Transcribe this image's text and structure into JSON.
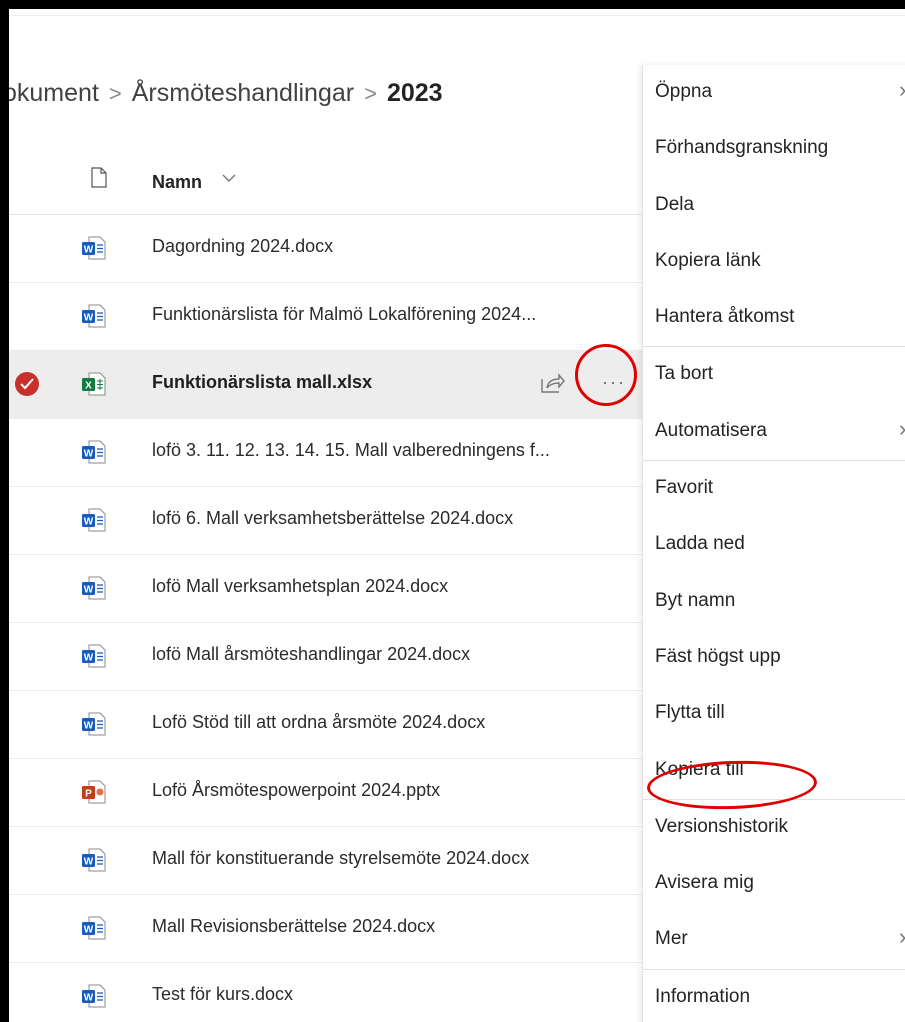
{
  "breadcrumb": {
    "part1": "okument",
    "part2": "Årsmöteshandlingar",
    "current": "2023"
  },
  "list": {
    "header": {
      "name": "Namn",
      "sort_icon": "chevron-down-icon"
    },
    "files": [
      {
        "name": "Dagordning 2024.docx",
        "type": "word"
      },
      {
        "name": "Funktionärslista för Malmö Lokalförening 2024...",
        "type": "word"
      },
      {
        "name": "Funktionärslista mall.xlsx",
        "type": "excel",
        "selected": true
      },
      {
        "name": "lofö 3. 11. 12. 13. 14. 15. Mall valberedningens f...",
        "type": "word"
      },
      {
        "name": "lofö 6. Mall verksamhetsberättelse 2024.docx",
        "type": "word"
      },
      {
        "name": "lofö Mall verksamhetsplan 2024.docx",
        "type": "word"
      },
      {
        "name": "lofö Mall årsmöteshandlingar 2024.docx",
        "type": "word"
      },
      {
        "name": "Lofö Stöd till att ordna årsmöte 2024.docx",
        "type": "word"
      },
      {
        "name": "Lofö Årsmötespowerpoint 2024.pptx",
        "type": "powerpoint"
      },
      {
        "name": "Mall för konstituerande styrelsemöte 2024.docx",
        "type": "word"
      },
      {
        "name": "Mall Revisionsberättelse 2024.docx",
        "type": "word"
      },
      {
        "name": "Test för kurs.docx",
        "type": "word"
      }
    ],
    "more_label": "···"
  },
  "menu": {
    "items": [
      "Öppna",
      "Förhandsgranskning",
      "Dela",
      "Kopiera länk",
      "Hantera åtkomst",
      "Ta bort",
      "Automatisera",
      "Favorit",
      "Ladda ned",
      "Byt namn",
      "Fäst högst upp",
      "Flytta till",
      "Kopiera till",
      "Versionshistorik",
      "Avisera mig",
      "Mer",
      "Information"
    ],
    "submenu_arrow": "›"
  },
  "colors": {
    "word": "#185abd",
    "excel": "#107c41",
    "powerpoint": "#c43e1c",
    "annotation": "#e00000",
    "selected_check": "#c8302c"
  }
}
